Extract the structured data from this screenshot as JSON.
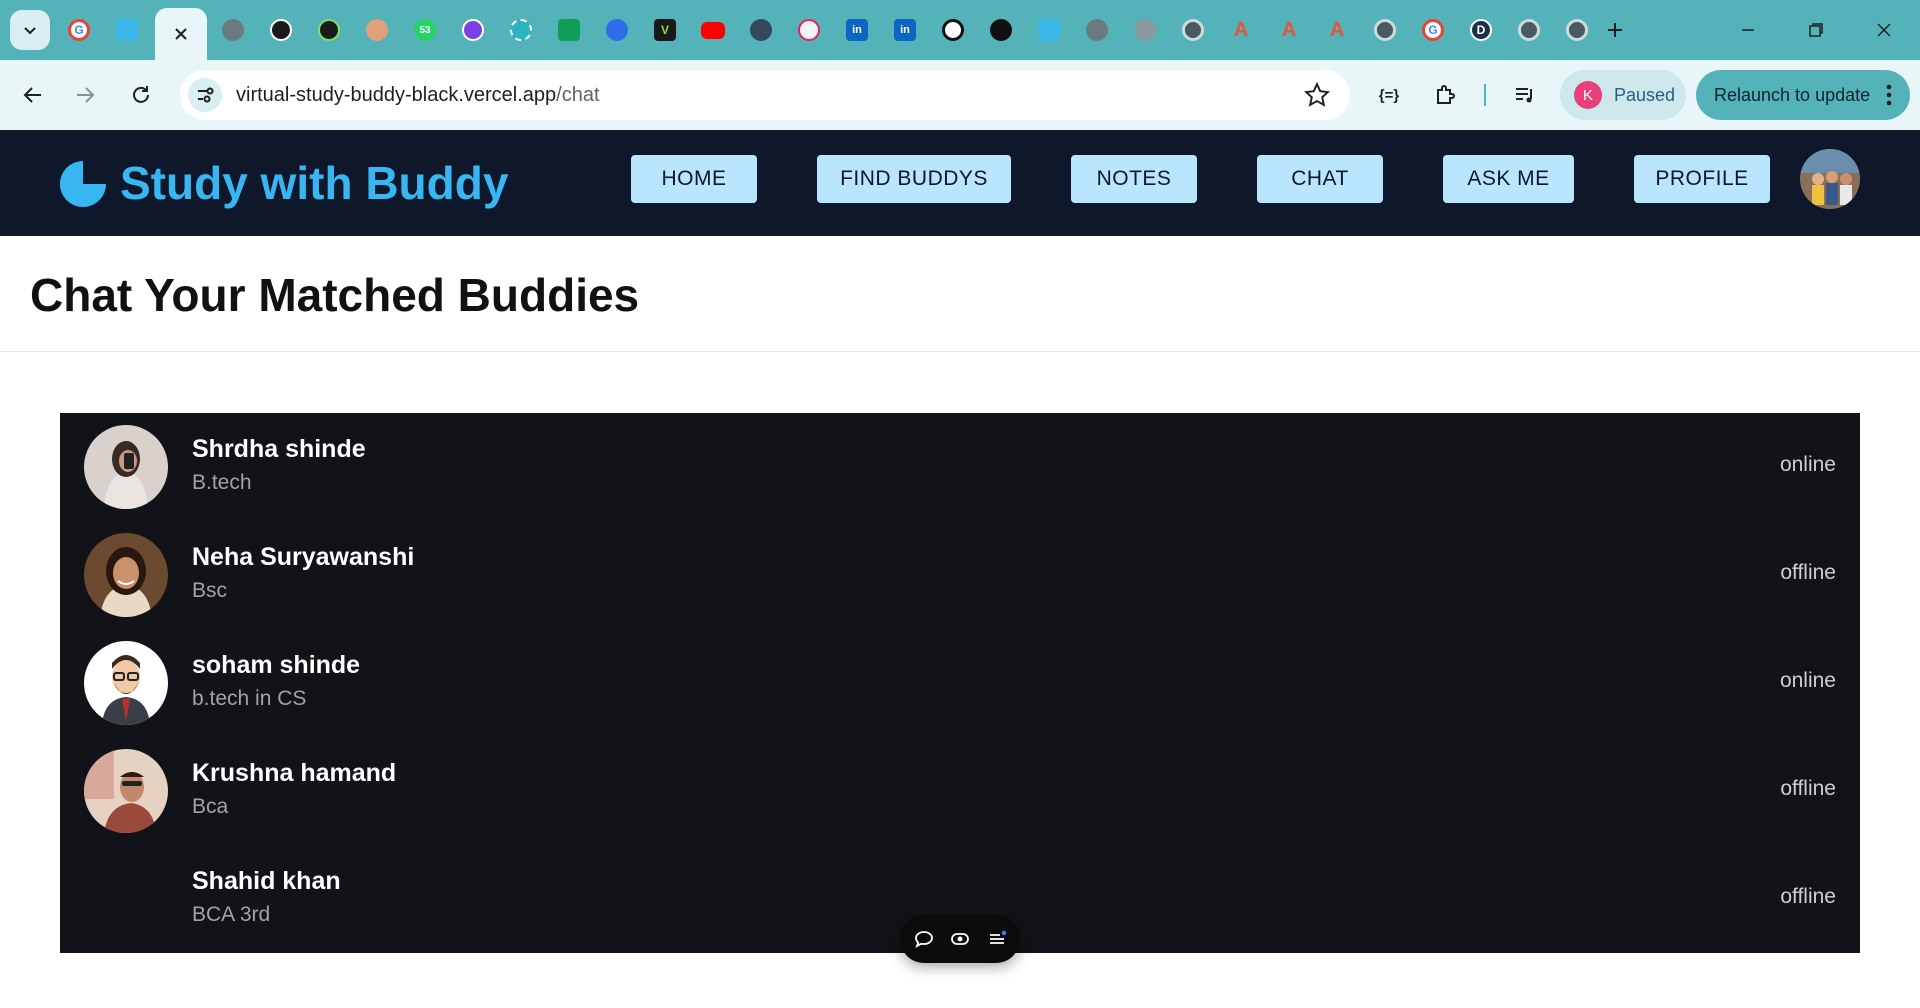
{
  "browser": {
    "url_host": "virtual-study-buddy-black.vercel.app",
    "url_path": "/chat",
    "profile_initial": "K",
    "profile_status": "Paused",
    "relaunch_label": "Relaunch to update",
    "tab_badge_count": "53",
    "tab_letter_d": "D",
    "accent_color": "#53b3b9"
  },
  "site": {
    "brand": "Study with Buddy",
    "brand_color": "#38b6f1",
    "nav": [
      {
        "label": "HOME"
      },
      {
        "label": "FIND BUDDYS"
      },
      {
        "label": "NOTES"
      },
      {
        "label": "CHAT"
      },
      {
        "label": "ASK ME"
      },
      {
        "label": "PROFILE"
      }
    ]
  },
  "page": {
    "title": "Chat Your Matched Buddies"
  },
  "buddies": [
    {
      "name": "Shrdha shinde",
      "course": "B.tech",
      "status": "online",
      "avatar": "photo-avatar"
    },
    {
      "name": "Neha Suryawanshi",
      "course": "Bsc",
      "status": "offline",
      "avatar": "photo-avatar"
    },
    {
      "name": "soham shinde",
      "course": "b.tech in CS",
      "status": "online",
      "avatar": "cartoon-avatar"
    },
    {
      "name": "Krushna hamand",
      "course": "Bca",
      "status": "offline",
      "avatar": "photo-avatar"
    },
    {
      "name": "Shahid khan",
      "course": "BCA 3rd",
      "status": "offline",
      "avatar": "none"
    }
  ],
  "floating_toolbar": {
    "icons": [
      "comment-icon",
      "eye-icon",
      "list-icon"
    ]
  }
}
